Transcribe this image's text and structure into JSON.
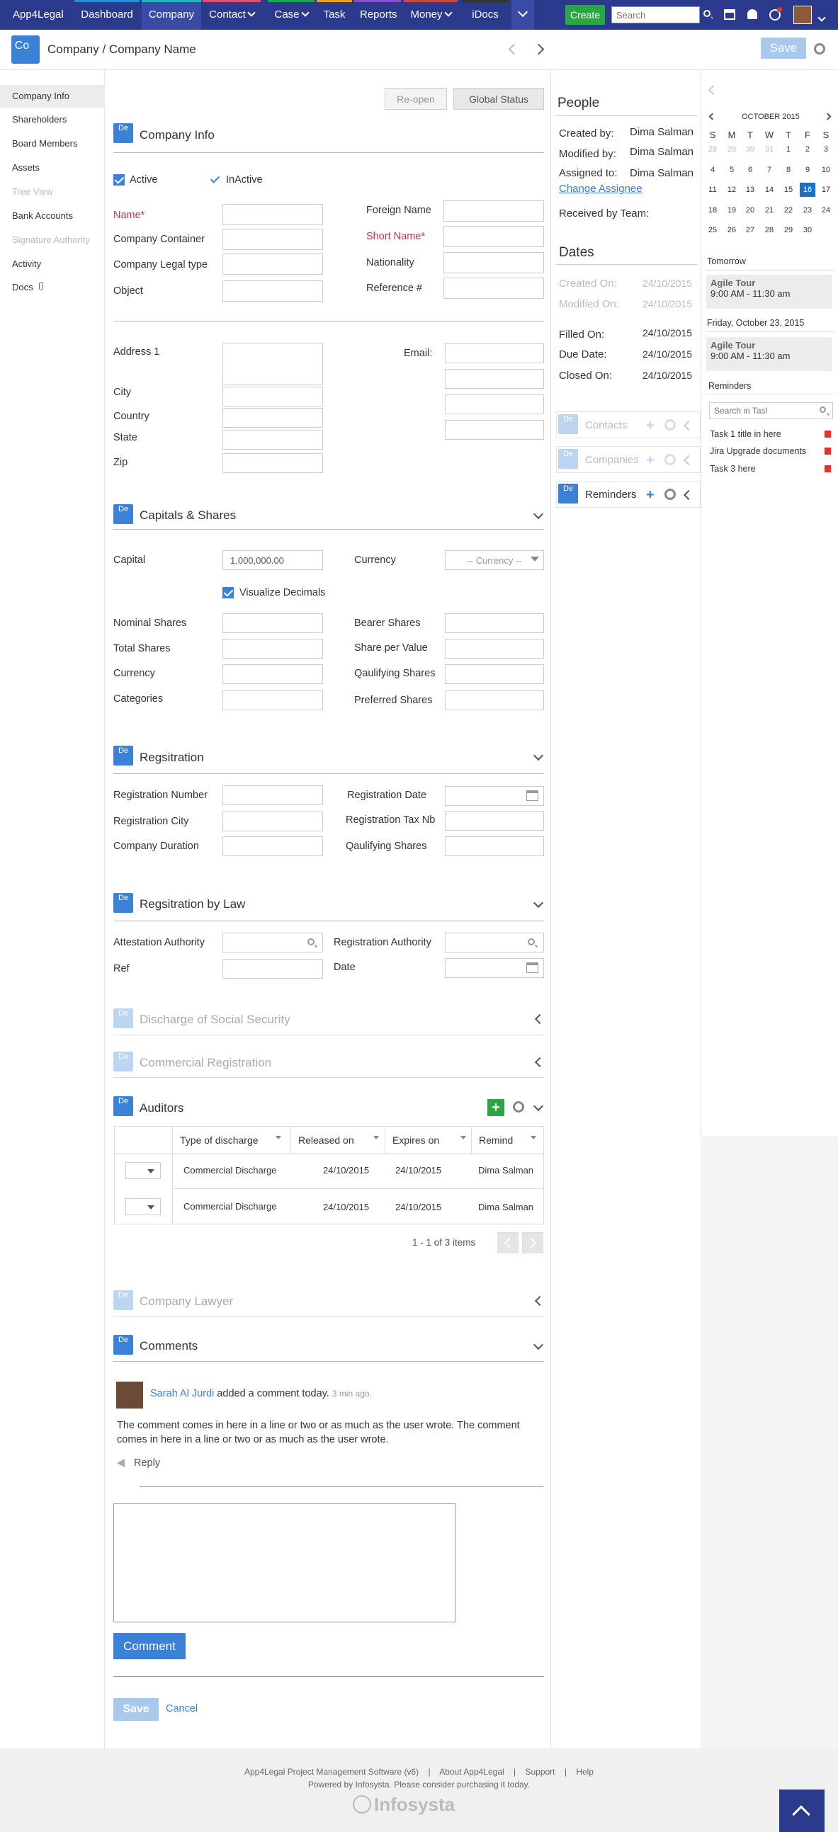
{
  "nav": {
    "brand": "App4Legal",
    "items": [
      {
        "label": "Dashboard",
        "color": "#2a8bd8"
      },
      {
        "label": "Company",
        "color": "#2bb3c2"
      },
      {
        "label": "Contact",
        "color": "#e14c7a"
      },
      {
        "label": "Case",
        "color": "#1fa35c"
      },
      {
        "label": "Task",
        "color": "#e2a22a"
      },
      {
        "label": "Reports",
        "color": "#8b4cc7"
      },
      {
        "label": "Money",
        "color": "#c94444"
      },
      {
        "label": "iDocs",
        "color": "#333"
      }
    ],
    "create_label": "Create",
    "search_placeholder": "Search"
  },
  "header": {
    "badge": "Co",
    "title": "Company / Company Name",
    "save_label": "Save"
  },
  "sidebar": {
    "items": [
      {
        "label": "Company Info",
        "state": "active"
      },
      {
        "label": "Shareholders",
        "state": "normal"
      },
      {
        "label": "Board Members",
        "state": "normal"
      },
      {
        "label": "Assets",
        "state": "normal"
      },
      {
        "label": "Tree View",
        "state": "disabled"
      },
      {
        "label": "Bank Accounts",
        "state": "normal"
      },
      {
        "label": "Signature Authority",
        "state": "disabled"
      },
      {
        "label": "Activity",
        "state": "normal"
      },
      {
        "label": "Docs",
        "state": "normal"
      }
    ]
  },
  "actions": {
    "reopen": "Re-open",
    "global_status": "Global Status"
  },
  "company_info": {
    "badge": "De",
    "title": "Company Info",
    "active": "Active",
    "inactive": "InActive",
    "name": "Name*",
    "company_container": "Company Container",
    "legal_type": "Company Legal type",
    "object": "Object",
    "foreign_name": "Foreign Name",
    "short_name": "Short Name*",
    "nationality": "Nationality",
    "reference": "Reference #",
    "address1": "Address 1",
    "city": "City",
    "country": "Country",
    "state": "State",
    "zip": "Zip",
    "email": "Email:"
  },
  "capitals": {
    "badge": "De",
    "title": "Capitals & Shares",
    "capital": "Capital",
    "capital_value": "1,000,000.00",
    "currency": "Currency",
    "currency_select": "-- Currency --",
    "visualize_decimals": "Visualize Decimals",
    "nominal_shares": "Nominal Shares",
    "total_shares": "Total Shares",
    "currency2": "Currency",
    "categories": "Categories",
    "bearer_shares": "Bearer Shares",
    "share_per_value": "Share per Value",
    "qualifying_shares": "Qaulifying Shares",
    "preferred_shares": "Preferred Shares"
  },
  "registration": {
    "badge": "De",
    "title": "Regsitration",
    "number": "Registration Number",
    "city": "Registration City",
    "duration": "Company Duration",
    "date": "Registration Date",
    "tax": "Registration Tax Nb",
    "qualifying": "Qaulifying Shares"
  },
  "reg_by_law": {
    "badge": "De",
    "title": "Regsitration by Law",
    "attestation": "Attestation Authority",
    "ref": "Ref",
    "authority": "Registration Authority",
    "date": "Date"
  },
  "discharge": {
    "badge": "De",
    "title": "Discharge of Social Security"
  },
  "commercial": {
    "badge": "De",
    "title": "Commercial Registration"
  },
  "auditors": {
    "badge": "De",
    "title": "Auditors",
    "columns": [
      "Type of discharge",
      "Released on",
      "Expires on",
      "Remind"
    ],
    "rows": [
      {
        "type": "Commercial Discharge",
        "released": "24/10/2015",
        "expires": "24/10/2015",
        "remind": "Dima Salman"
      },
      {
        "type": "Commercial Discharge",
        "released": "24/10/2015",
        "expires": "24/10/2015",
        "remind": "Dima Salman"
      }
    ],
    "pager": "1 - 1 of 3 items"
  },
  "lawyer": {
    "badge": "De",
    "title": "Company Lawyer"
  },
  "comments": {
    "badge": "De",
    "title": "Comments",
    "author": "Sarah Al Jurdi",
    "action": "added a comment today.",
    "ago": "3 min ago.",
    "text": "The comment comes in here in a line or two or as much as the user wrote. The comment comes in here in a line or two or as much as the user wrote.",
    "reply": "Reply",
    "comment_btn": "Comment"
  },
  "form_actions": {
    "save": "Save",
    "cancel": "Cancel"
  },
  "people": {
    "title": "People",
    "created_by": "Created by:",
    "created_by_val": "Dima Salman",
    "modified_by": "Modified by:",
    "modified_by_val": "Dima Salman",
    "assigned_to": "Assigned to:",
    "assigned_to_val": "Dima Salman",
    "change_assignee": "Change Assignee",
    "received_by": "Received by Team:"
  },
  "dates": {
    "title": "Dates",
    "created_on": "Created On:",
    "created_on_val": "24/10/2015",
    "modified_on": "Modified On:",
    "modified_on_val": "24/10/2015",
    "filled_on": "Filled On:",
    "filled_on_val": "24/10/2015",
    "due_date": "Due Date:",
    "due_date_val": "24/10/2015",
    "closed_on": "Closed On:",
    "closed_on_val": "24/10/2015"
  },
  "panels": {
    "contacts": "Contacts",
    "companies": "Companies",
    "reminders": "Reminders",
    "badge": "De"
  },
  "calendar": {
    "month": "OCTOBER 2015",
    "weekdays": [
      "S",
      "M",
      "T",
      "W",
      "T",
      "F",
      "S"
    ],
    "weeks": [
      [
        "28",
        "29",
        "30",
        "31",
        "1",
        "2",
        "3"
      ],
      [
        "4",
        "5",
        "6",
        "7",
        "8",
        "9",
        "10"
      ],
      [
        "11",
        "12",
        "13",
        "14",
        "15",
        "16",
        "17"
      ],
      [
        "18",
        "19",
        "20",
        "21",
        "22",
        "23",
        "24"
      ],
      [
        "25",
        "26",
        "27",
        "28",
        "29",
        "30",
        ""
      ]
    ],
    "today": "16",
    "tomorrow_label": "Tomorrow",
    "event1_title": "Agile Tour",
    "event1_time": "9:00 AM - 11:30 am",
    "day2_label": "Friday, October 23, 2015",
    "event2_title": "Agile Tour",
    "event2_time": "9:00 AM - 11:30 am",
    "reminders_label": "Reminders",
    "search_placeholder": "Search in Tasl",
    "tasks": [
      "Task 1 title in here",
      "Jira Upgrade documents",
      "Task 3 here"
    ]
  },
  "footer": {
    "product": "App4Legal Project Management Software (v6)",
    "sep": "|",
    "about": "About App4Legal",
    "support": "Support",
    "help": "Help",
    "powered": "Powered by Infosysta. Please consider purchasing it today.",
    "logo": "Infosysta"
  }
}
